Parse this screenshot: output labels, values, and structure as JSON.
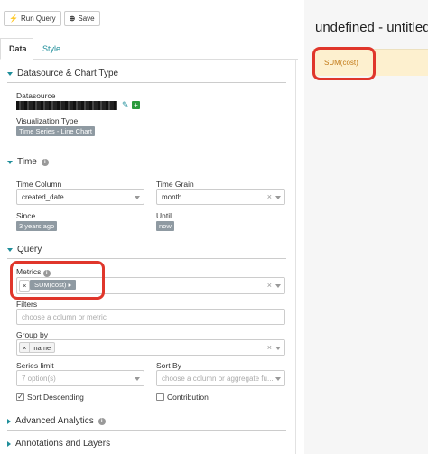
{
  "toolbar": {
    "run_query": "Run Query",
    "save": "Save"
  },
  "tabs": {
    "data": "Data",
    "style": "Style"
  },
  "datasource_section": {
    "title": "Datasource & Chart Type",
    "datasource_label": "Datasource",
    "viz_label": "Visualization Type",
    "viz_value": "Time Series - Line Chart"
  },
  "time_section": {
    "title": "Time",
    "time_column_label": "Time Column",
    "time_column_value": "created_date",
    "time_grain_label": "Time Grain",
    "time_grain_value": "month",
    "since_label": "Since",
    "since_value": "3 years ago",
    "until_label": "Until",
    "until_value": "now"
  },
  "query_section": {
    "title": "Query",
    "metrics_label": "Metrics",
    "metric_value": "SUM(cost)",
    "filters_label": "Filters",
    "filters_placeholder": "choose a column or metric",
    "groupby_label": "Group by",
    "groupby_value": "name",
    "series_limit_label": "Series limit",
    "series_limit_placeholder": "7 option(s)",
    "sort_by_label": "Sort By",
    "sort_by_placeholder": "choose a column or aggregate fu...",
    "sort_desc_label": "Sort Descending",
    "contribution_label": "Contribution"
  },
  "advanced_section": {
    "title": "Advanced Analytics"
  },
  "annotations_section": {
    "title": "Annotations and Layers"
  },
  "chart_panel": {
    "title": "undefined - untitled",
    "metric_header": "SUM(cost)"
  },
  "colors": {
    "accent": "#1f8e9a",
    "highlight": "#e0362b",
    "tag": "#8f9aa2"
  }
}
